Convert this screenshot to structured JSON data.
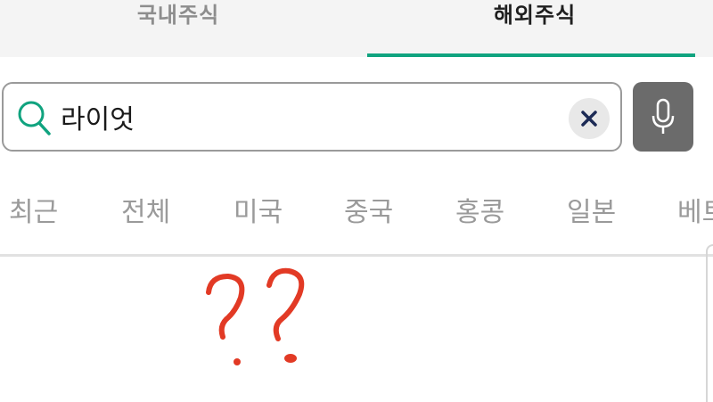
{
  "market_tabs": [
    {
      "label": "국내주식",
      "active": false
    },
    {
      "label": "해외주식",
      "active": true
    }
  ],
  "search": {
    "value": "라이엇",
    "search_icon": "search-icon",
    "clear_icon": "close-icon",
    "voice_icon": "microphone-icon"
  },
  "region_filters": [
    "최근",
    "전체",
    "미국",
    "중국",
    "홍콩",
    "일본",
    "베트"
  ],
  "annotation": {
    "text": "??",
    "color": "#e23a25"
  },
  "colors": {
    "accent": "#10a37f",
    "voice_button": "#6b6b6b",
    "inactive_text": "#9a9a9a"
  }
}
